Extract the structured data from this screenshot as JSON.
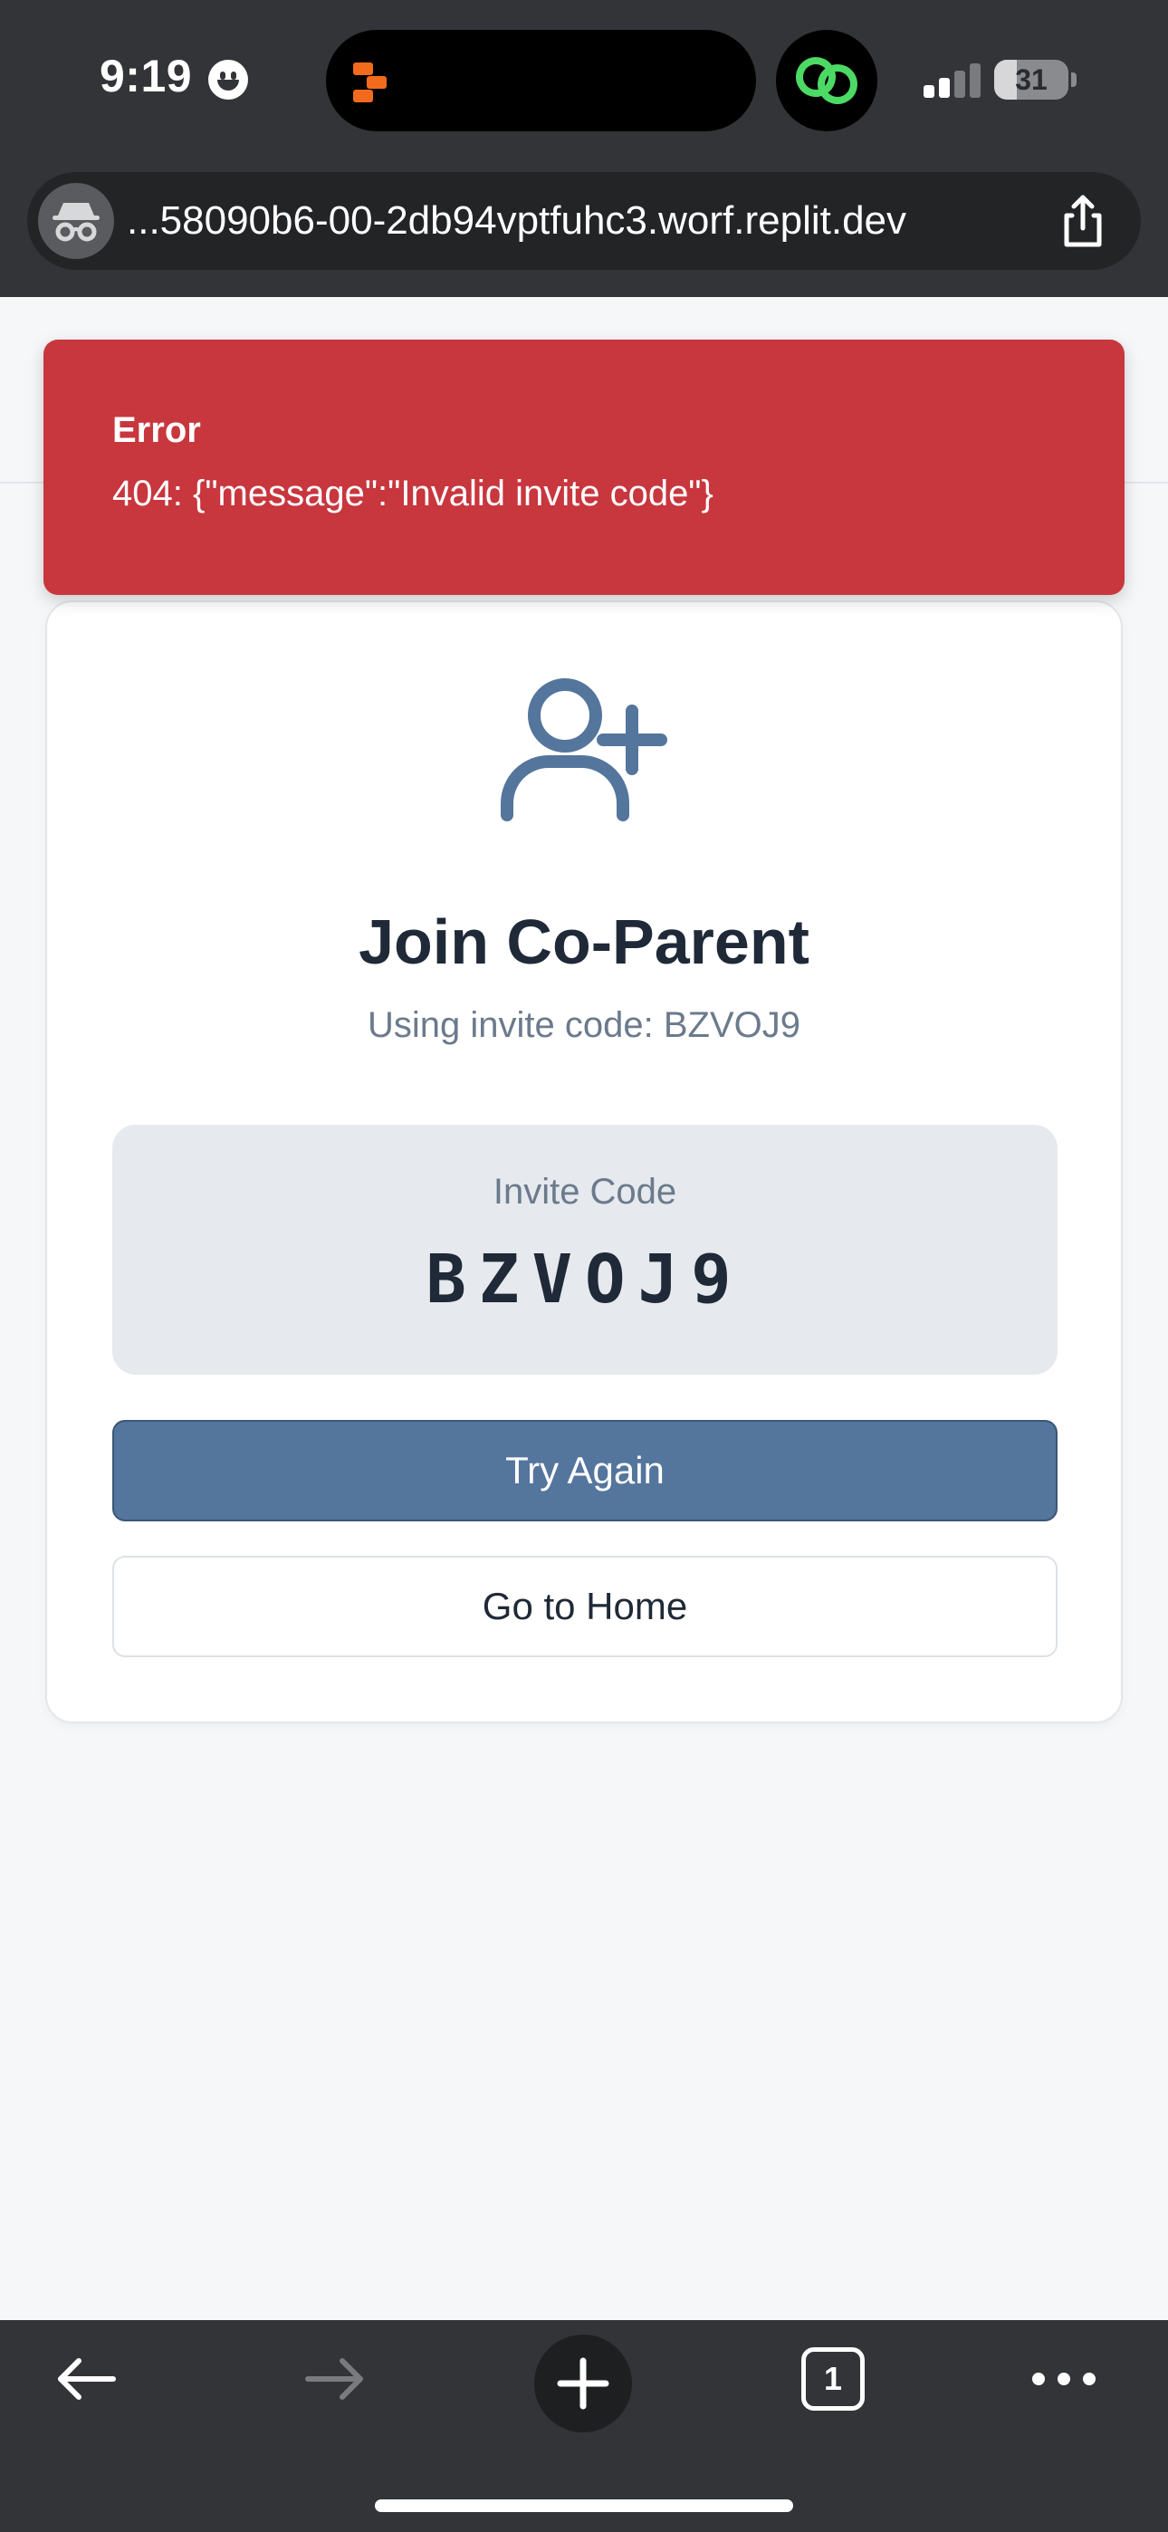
{
  "status_bar": {
    "time": "9:19",
    "battery_level": 31,
    "battery_text": "31",
    "signal_bars_active": 2,
    "signal_bars_total": 4
  },
  "browser": {
    "url": "...58090b6-00-2db94vptfuhc3.worf.replit.dev",
    "open_tabs_count": "1",
    "mode": "incognito",
    "icons": {
      "mode": "incognito-icon",
      "share": "share-icon",
      "back": "back-arrow-icon",
      "forward": "forward-arrow-icon",
      "new_tab": "plus-icon",
      "tabs": "tabs-icon",
      "more": "more-icon"
    }
  },
  "error_toast": {
    "title": "Error",
    "message": "404: {\"message\":\"Invalid invite code\"}",
    "color": "#c8363e"
  },
  "join_card": {
    "icon": "user-plus-icon",
    "title": "Join Co-Parent",
    "subtitle": "Using invite code: BZVOJ9",
    "code_label": "Invite Code",
    "code_value": "BZVOJ9",
    "primary_button": "Try Again",
    "secondary_button": "Go to Home",
    "accent_color": "#54759c"
  }
}
